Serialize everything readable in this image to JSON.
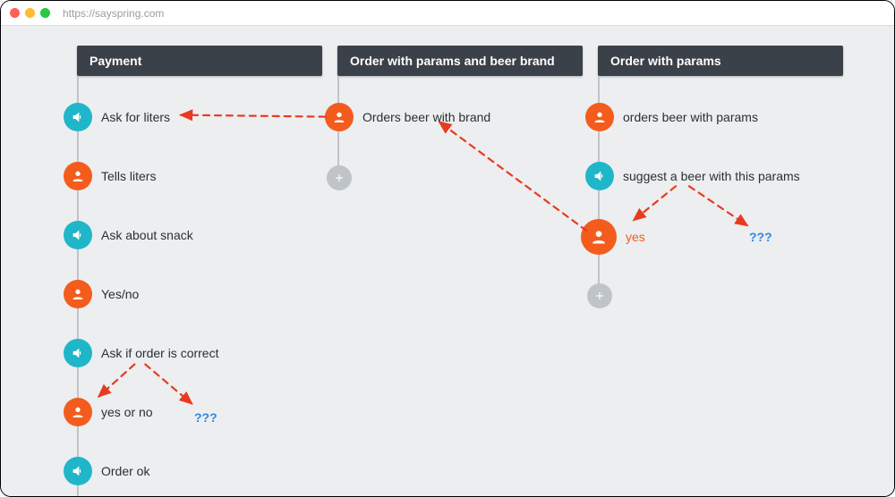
{
  "browser": {
    "url": "https://sayspring.com"
  },
  "columns": {
    "payment": {
      "title": "Payment",
      "nodes": [
        {
          "kind": "speaker",
          "label": "Ask for liters"
        },
        {
          "kind": "user",
          "label": "Tells liters"
        },
        {
          "kind": "speaker",
          "label": "Ask about snack"
        },
        {
          "kind": "user",
          "label": "Yes/no"
        },
        {
          "kind": "speaker",
          "label": "Ask if order is correct"
        },
        {
          "kind": "user",
          "label": "yes or no"
        },
        {
          "kind": "speaker",
          "label": "Order ok"
        }
      ],
      "unknown_branch_label": "???"
    },
    "order_with_brand": {
      "title": "Order with params and beer brand",
      "nodes": [
        {
          "kind": "user",
          "label": "Orders beer with brand"
        },
        {
          "kind": "add",
          "label": ""
        }
      ]
    },
    "order_with_params": {
      "title": "Order with params",
      "nodes": [
        {
          "kind": "user",
          "label": "orders beer with params"
        },
        {
          "kind": "speaker",
          "label": "suggest a beer with this params"
        },
        {
          "kind": "user",
          "label": "yes",
          "emphasis": true
        },
        {
          "kind": "add",
          "label": ""
        }
      ],
      "unknown_branch_label": "???"
    }
  },
  "connections": [
    {
      "from": "order_with_brand.nodes.0",
      "to": "payment.nodes.0"
    },
    {
      "from": "order_with_params.nodes.2",
      "to": "order_with_brand.nodes.0"
    },
    {
      "from": "order_with_params.nodes.1",
      "to": "order_with_params.nodes.2"
    },
    {
      "from": "order_with_params.nodes.1",
      "to": "order_with_params.unknown_branch"
    },
    {
      "from": "payment.nodes.4",
      "to": "payment.nodes.5"
    },
    {
      "from": "payment.nodes.4",
      "to": "payment.unknown_branch"
    }
  ],
  "colors": {
    "speaker": "#20b6c9",
    "user": "#f35c1c",
    "header": "#3b4148",
    "canvas": "#eceef0",
    "arrow": "#e83a1f",
    "link": "#2f86e4"
  }
}
